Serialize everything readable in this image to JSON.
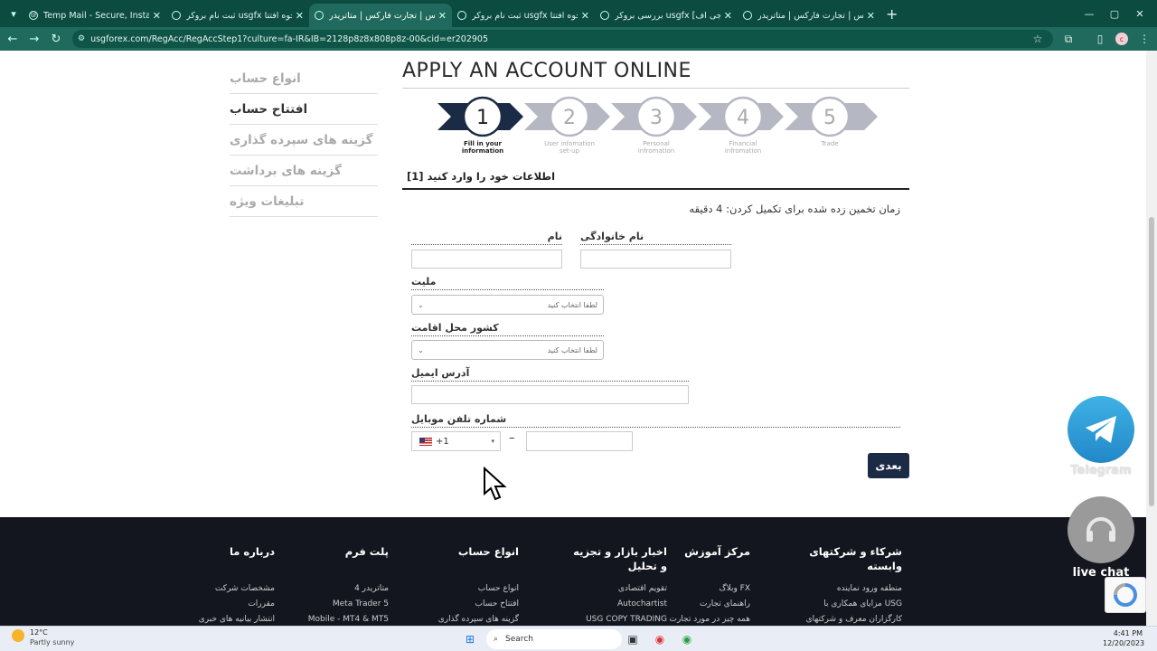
{
  "browser": {
    "tabs": [
      {
        "title": "Temp Mail - Secure, Instant, Fast",
        "active": false
      },
      {
        "title": "ثبت نام بروکر usgfx نحوه افتتا",
        "active": false
      },
      {
        "title": "فارکس | تجارت فارکس | متاتریدر",
        "active": true
      },
      {
        "title": "ثبت نام بروکر usgfx نحوه افتتا",
        "active": false
      },
      {
        "title": "بررسی بروکر usgfx [یو اس جی اف",
        "active": false
      },
      {
        "title": "فارکس | تجارت فارکس | متاتریدر",
        "active": false
      }
    ],
    "new_tab": "+",
    "url": "usgforex.com/RegAcc/RegAccStep1?culture=fa-IR&IB=2128p8z8x808p8z-00&cid=er202905",
    "profile_initial": "c"
  },
  "sidebar": {
    "items": [
      {
        "label": "انواع حساب",
        "active": false
      },
      {
        "label": "افتتاح حساب",
        "active": true
      },
      {
        "label": "گزینه های سپرده گذاری",
        "active": false
      },
      {
        "label": "گزینه های برداشت",
        "active": false
      },
      {
        "label": "تبلیغات ویژه",
        "active": false
      }
    ]
  },
  "main": {
    "title": "APPLY AN ACCOUNT ONLINE",
    "steps": [
      {
        "number": "1",
        "label1": "Fill in your",
        "label2": "information",
        "active": true
      },
      {
        "number": "2",
        "label1": "User infomation",
        "label2": "set-up",
        "active": false
      },
      {
        "number": "3",
        "label1": "Personal",
        "label2": "infromation",
        "active": false
      },
      {
        "number": "4",
        "label1": "Financial",
        "label2": "infromation",
        "active": false
      },
      {
        "number": "5",
        "label1": "Trade",
        "label2": "",
        "active": false
      }
    ],
    "section_title": "اطلاعات خود را وارد کنید [1]",
    "estimated_time": "زمان تخمین زده شده برای تکمیل کردن: 4 دقیقه",
    "form": {
      "first_name_label": "نام",
      "last_name_label": "نام خانوادگی",
      "nationality_label": "ملیت",
      "nationality_value": "لطفا انتخاب کنید",
      "residence_label": "کشور محل اقامت",
      "residence_value": "لطفا انتخاب کنید",
      "email_label": "آدرس ایمیل",
      "phone_label": "شماره تلفن موبایل",
      "phone_code": "+1",
      "phone_sep": "–",
      "next_label": "بعدی"
    }
  },
  "widgets": {
    "telegram_label": "Telegram",
    "livechat_label": "live chat"
  },
  "footer": {
    "columns": [
      {
        "title": "درباره ما",
        "links": [
          "مشخصات شرکت",
          "مقررات",
          "انتشار بیانیه های خبری"
        ]
      },
      {
        "title": "پلت فرم",
        "links": [
          "متاتریدر 4",
          "Meta Trader 5",
          "Mobile - MT4 & MT5"
        ]
      },
      {
        "title": "انواع حساب",
        "links": [
          "انواع حساب",
          "افتتاح حساب",
          "گزینه های سپرده گذاری"
        ]
      },
      {
        "title": "اخبار بازار و تجزیه و تحلیل",
        "links": [
          "تقویم اقتصادی",
          "Autochartist",
          "USG COPY TRADING"
        ]
      },
      {
        "title": "مرکز آموزش",
        "links": [
          "FX وبلاگ",
          "راهنمای تجارت",
          "همه چیز در مورد تجارت"
        ]
      },
      {
        "title": "شرکاء و شرکتهای وابسته",
        "links": [
          "منطقه ورود نماینده",
          "USG مزایای همکاری با",
          "کارگزاران معرف و شرکتهای"
        ]
      }
    ]
  },
  "taskbar": {
    "temperature": "12°C",
    "weather": "Partly sunny",
    "search_placeholder": "Search",
    "time": "4:41 PM",
    "date": "12/20/2023"
  },
  "colors": {
    "browser_bg": "#0b4b40",
    "step_active": "#1c2b45",
    "step_inactive": "#b5b7c2",
    "footer_bg": "#14161f",
    "telegram": "#2ea6da"
  }
}
